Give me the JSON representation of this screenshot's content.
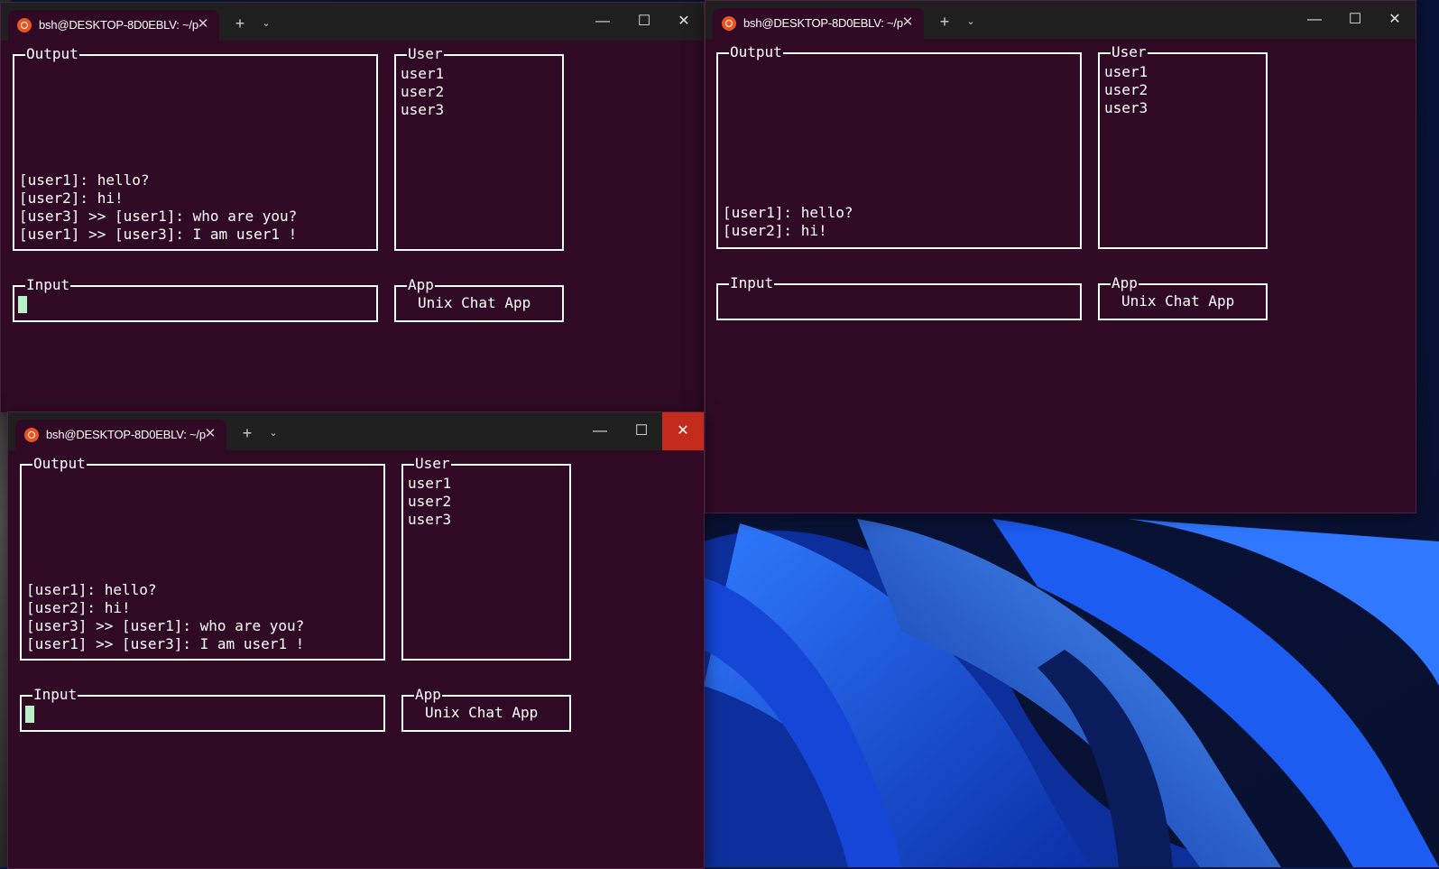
{
  "desktop": {
    "accent": "#1e5bf0"
  },
  "windows": [
    {
      "id": "top-left",
      "tab_title": "bsh@DESKTOP-8D0EBLV: ~/p",
      "tab_close": "✕",
      "new_tab": "+",
      "dropdown": "⌄",
      "minimize": "—",
      "maximize": "☐",
      "close": "✕",
      "output_title": "Output",
      "output_lines": [
        "[user1]: hello?",
        "[user2]: hi!",
        "[user3] >> [user1]: who are you?",
        "[user1] >> [user3]: I am user1 !"
      ],
      "user_title": "User",
      "users": [
        "user1",
        "user2",
        "user3"
      ],
      "input_title": "Input",
      "input_value": "",
      "app_title": "App",
      "app_name": "Unix Chat App"
    },
    {
      "id": "right",
      "tab_title": "bsh@DESKTOP-8D0EBLV: ~/p",
      "tab_close": "✕",
      "new_tab": "+",
      "dropdown": "⌄",
      "minimize": "—",
      "maximize": "☐",
      "close": "✕",
      "output_title": "Output",
      "output_lines": [
        "[user1]: hello?",
        "[user2]: hi!"
      ],
      "user_title": "User",
      "users": [
        "user1",
        "user2",
        "user3"
      ],
      "input_title": "Input",
      "input_value": "",
      "app_title": "App",
      "app_name": "Unix Chat App"
    },
    {
      "id": "bottom-left",
      "tab_title": "bsh@DESKTOP-8D0EBLV: ~/p",
      "tab_close": "✕",
      "new_tab": "+",
      "dropdown": "⌄",
      "minimize": "—",
      "maximize": "☐",
      "close": "✕",
      "output_title": "Output",
      "output_lines": [
        "[user1]: hello?",
        "[user2]: hi!",
        "[user3] >> [user1]: who are you?",
        "[user1] >> [user3]: I am user1 !"
      ],
      "user_title": "User",
      "users": [
        "user1",
        "user2",
        "user3"
      ],
      "input_title": "Input",
      "input_value": "",
      "app_title": "App",
      "app_name": "Unix Chat App"
    }
  ]
}
